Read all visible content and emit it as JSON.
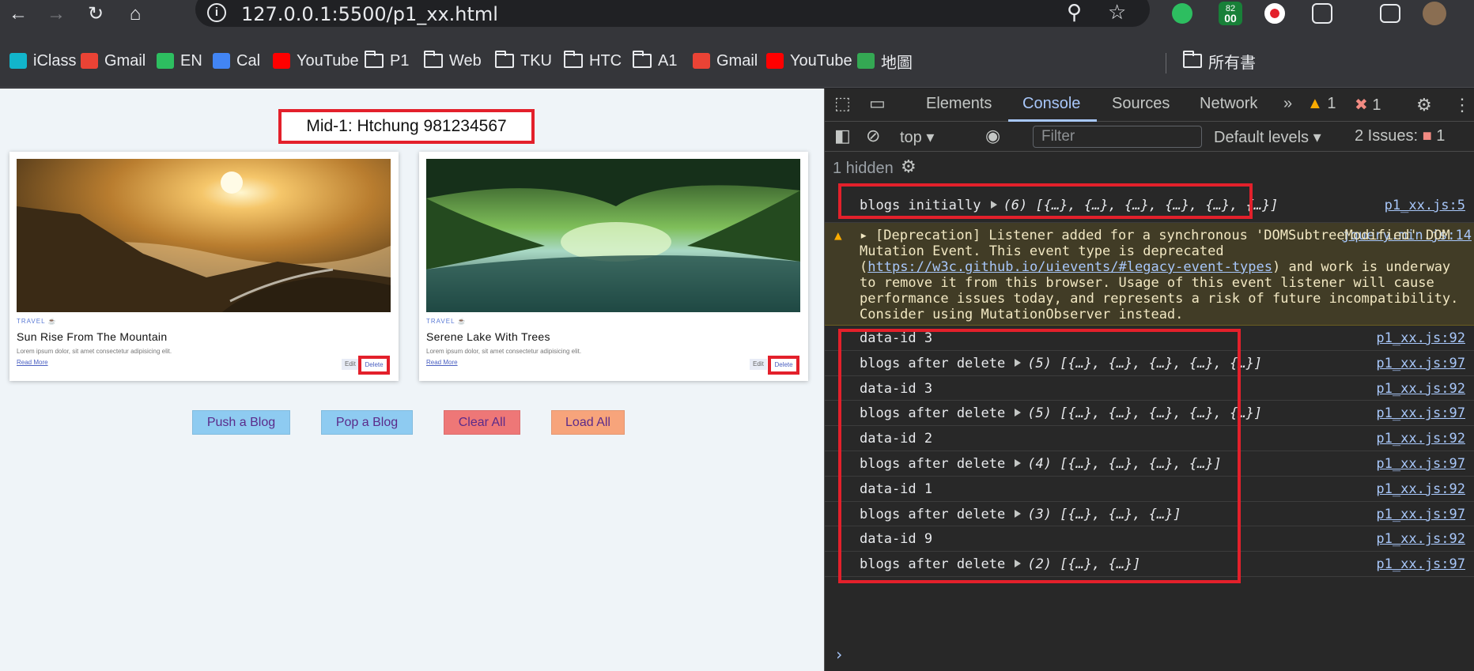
{
  "browser": {
    "url": "127.0.0.1:5500/p1_xx.html",
    "badge_top": "82",
    "badge_bottom": "00"
  },
  "bookmarks": [
    {
      "label": "iClass",
      "icon": "iclass-icon",
      "color": "#12b5cb"
    },
    {
      "label": "Gmail",
      "icon": "gmail-icon",
      "color": "#ea4335"
    },
    {
      "label": "EN",
      "icon": "evernote-icon",
      "color": "#2dbe60"
    },
    {
      "label": "Cal",
      "icon": "calendar-icon",
      "color": "#4285f4"
    },
    {
      "label": "YouTube",
      "icon": "youtube-icon",
      "color": "#ff0000"
    },
    {
      "label": "P1",
      "icon": "folder-icon"
    },
    {
      "label": "Web",
      "icon": "folder-icon"
    },
    {
      "label": "TKU",
      "icon": "folder-icon"
    },
    {
      "label": "HTC",
      "icon": "folder-icon"
    },
    {
      "label": "A1",
      "icon": "folder-icon"
    },
    {
      "label": "Gmail",
      "icon": "gmail-icon",
      "color": "#ea4335"
    },
    {
      "label": "YouTube",
      "icon": "youtube-icon",
      "color": "#ff0000"
    },
    {
      "label": "地圖",
      "icon": "maps-icon",
      "color": "#34a853"
    },
    {
      "label": "所有書",
      "icon": "folder-icon"
    }
  ],
  "page": {
    "title": "Mid-1: Htchung 981234567",
    "cards": [
      {
        "category": "TRAVEL",
        "title": "Sun Rise From The Mountain",
        "text": "Lorem ipsum dolor, sit amet consectetur adipisicing elit.",
        "more": "Read More",
        "edit": "Edit",
        "delete": "Delete"
      },
      {
        "category": "TRAVEL",
        "title": "Serene Lake With Trees",
        "text": "Lorem ipsum dolor, sit amet consectetur adipisicing elit.",
        "more": "Read More",
        "edit": "Edit",
        "delete": "Delete"
      }
    ],
    "buttons": [
      {
        "label": "Push a Blog",
        "color": "#8ecbf1"
      },
      {
        "label": "Pop a Blog",
        "color": "#8ecbf1"
      },
      {
        "label": "Clear All",
        "color": "#ee7777"
      },
      {
        "label": "Load All",
        "color": "#f7a47b"
      }
    ]
  },
  "devtools": {
    "tabs": [
      "Elements",
      "Console",
      "Sources",
      "Network"
    ],
    "more_tabs": "»",
    "warn_count": "1",
    "error_count": "1",
    "context": "top",
    "filter_placeholder": "Filter",
    "levels": "Default levels",
    "issues": "2 Issues:",
    "issues_count": "1",
    "hidden": "1 hidden",
    "initial_log": {
      "text": "blogs initially",
      "value": "(6) [{…}, {…}, {…}, {…}, {…}, {…}]",
      "src": "p1_xx.js:5"
    },
    "warning": {
      "pre": "[Deprecation] Listener added for a synchronous 'DOMSubtreeModified' DOM Mutation Event. This event type is deprecated (",
      "link": "https://w3c.github.io/uievents/#legacy-event-types",
      "post": ") and work is underway to remove it from this browser. Usage of this event listener will cause performance issues today, and represents a risk of future incompatibility. Consider using MutationObserver instead.",
      "src": "jquery.min.js:14"
    },
    "logs": [
      {
        "text": "data-id 3",
        "value": "",
        "src": "p1_xx.js:92"
      },
      {
        "text": "blogs after delete",
        "value": "(5) [{…}, {…}, {…}, {…}, {…}]",
        "src": "p1_xx.js:97"
      },
      {
        "text": "data-id 3",
        "value": "",
        "src": "p1_xx.js:92"
      },
      {
        "text": "blogs after delete",
        "value": "(5) [{…}, {…}, {…}, {…}, {…}]",
        "src": "p1_xx.js:97"
      },
      {
        "text": "data-id 2",
        "value": "",
        "src": "p1_xx.js:92"
      },
      {
        "text": "blogs after delete",
        "value": "(4) [{…}, {…}, {…}, {…}]",
        "src": "p1_xx.js:97"
      },
      {
        "text": "data-id 1",
        "value": "",
        "src": "p1_xx.js:92"
      },
      {
        "text": "blogs after delete",
        "value": "(3) [{…}, {…}, {…}]",
        "src": "p1_xx.js:97"
      },
      {
        "text": "data-id 9",
        "value": "",
        "src": "p1_xx.js:92"
      },
      {
        "text": "blogs after delete",
        "value": "(2) [{…}, {…}]",
        "src": "p1_xx.js:97"
      }
    ],
    "prompt": "›"
  }
}
